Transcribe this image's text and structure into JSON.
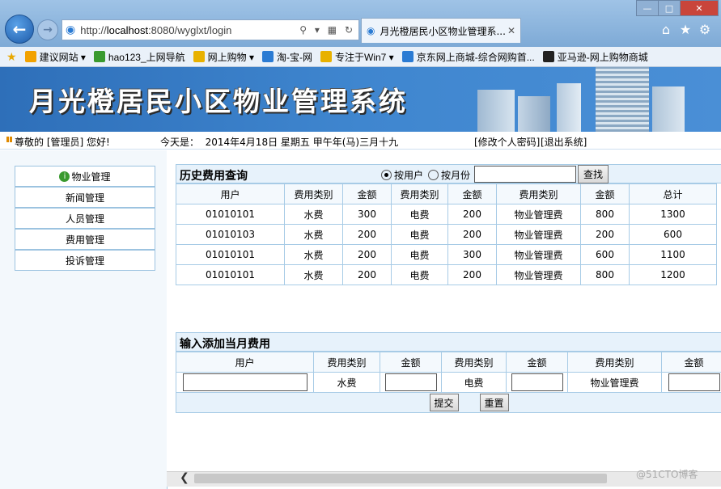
{
  "browser": {
    "address_url_prefix": "http://",
    "address_host": "localhost",
    "address_url_rest": ":8080/wyglxt/login",
    "tab_title": "月光橙居民小区物业管理系...",
    "favorites": [
      {
        "label": "建议网站 ▾",
        "icon": "bing-icon",
        "color": "#f2a200"
      },
      {
        "label": "hao123_上网导航",
        "icon": "hao123-icon",
        "color": "#3a9a2f"
      },
      {
        "label": "网上购物 ▾",
        "icon": "folder-icon",
        "color": "#e8b100"
      },
      {
        "label": "淘-宝-网",
        "icon": "ie-page-icon",
        "color": "#2b7bd3"
      },
      {
        "label": "专注于Win7 ▾",
        "icon": "folder-icon",
        "color": "#e8b100"
      },
      {
        "label": "京东网上商城-综合网购首...",
        "icon": "ie-page-icon",
        "color": "#2b7bd3"
      },
      {
        "label": "亚马逊-网上购物商城",
        "icon": "amazon-icon",
        "color": "#222222"
      }
    ]
  },
  "banner": {
    "title": "月光橙居民小区物业管理系统"
  },
  "infobar": {
    "greeting": "尊敬的 [管理员] 您好!",
    "date": "今天是：  2014年4月18日 星期五 甲午年(马)三月十九",
    "change_password": "[修改个人密码]",
    "logout": "[退出系统]"
  },
  "sidebar": {
    "items": [
      {
        "label": "物业管理"
      },
      {
        "label": "新闻管理"
      },
      {
        "label": "人员管理"
      },
      {
        "label": "费用管理"
      },
      {
        "label": "投诉管理"
      }
    ]
  },
  "history": {
    "title": "历史费用查询",
    "radio_user": "按用户",
    "radio_month": "按月份",
    "search_button": "查找",
    "headers": [
      "用户",
      "费用类别",
      "金额",
      "费用类别",
      "金额",
      "费用类别",
      "金额",
      "总计"
    ],
    "rows": [
      [
        "01010101",
        "水费",
        "300",
        "电费",
        "200",
        "物业管理费",
        "800",
        "1300"
      ],
      [
        "01010103",
        "水费",
        "200",
        "电费",
        "200",
        "物业管理费",
        "200",
        "600"
      ],
      [
        "01010101",
        "水费",
        "200",
        "电费",
        "300",
        "物业管理费",
        "600",
        "1100"
      ],
      [
        "01010101",
        "水费",
        "200",
        "电费",
        "200",
        "物业管理费",
        "800",
        "1200"
      ]
    ]
  },
  "add_form": {
    "title": "输入添加当月费用",
    "headers": [
      "用户",
      "费用类别",
      "金额",
      "费用类别",
      "金额",
      "费用类别",
      "金额"
    ],
    "water_label": "水费",
    "electric_label": "电费",
    "property_label": "物业管理费",
    "submit_button": "提交",
    "reset_button": "重置"
  },
  "watermark": "@51CTO博客"
}
